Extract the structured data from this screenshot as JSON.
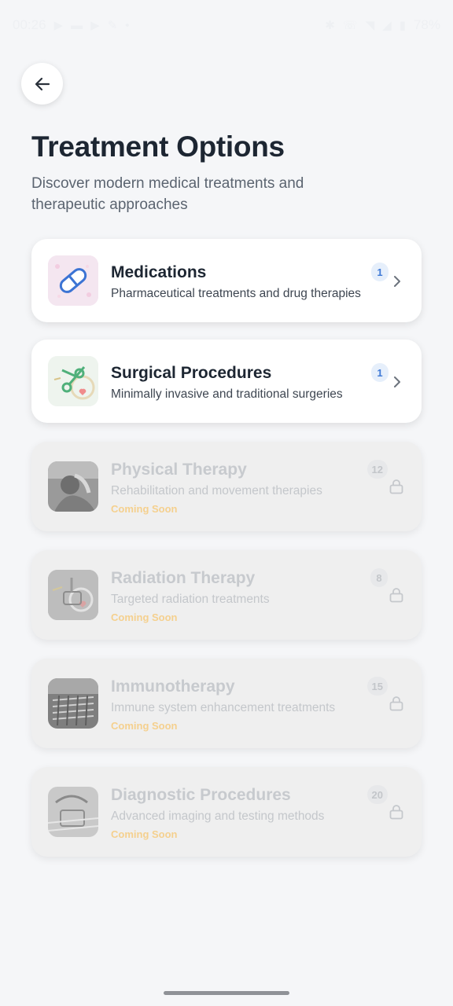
{
  "status_bar": {
    "time": "00:26",
    "battery": "78%"
  },
  "header": {
    "title": "Treatment Options",
    "subtitle": "Discover modern medical treatments and therapeutic approaches"
  },
  "categories": [
    {
      "title": "Medications",
      "description": "Pharmaceutical treatments and drug therapies",
      "count": "1",
      "locked": false,
      "icon": "pill-icon"
    },
    {
      "title": "Surgical Procedures",
      "description": "Minimally invasive and traditional surgeries",
      "count": "1",
      "locked": false,
      "icon": "scissors-icon"
    },
    {
      "title": "Physical Therapy",
      "description": "Rehabilitation and movement therapies",
      "count": "12",
      "locked": true,
      "status": "Coming Soon",
      "icon": "therapy-photo"
    },
    {
      "title": "Radiation Therapy",
      "description": "Targeted radiation treatments",
      "count": "8",
      "locked": true,
      "status": "Coming Soon",
      "icon": "stethoscope-icon"
    },
    {
      "title": "Immunotherapy",
      "description": "Immune system enhancement treatments",
      "count": "15",
      "locked": true,
      "status": "Coming Soon",
      "icon": "lab-photo"
    },
    {
      "title": "Diagnostic Procedures",
      "description": "Advanced imaging and testing methods",
      "count": "20",
      "locked": true,
      "status": "Coming Soon",
      "icon": "diagnostic-photo"
    }
  ],
  "colors": {
    "background": "#f5f6f8",
    "accent_badge": "#3f7ad6",
    "coming_soon": "#f5d08e"
  }
}
